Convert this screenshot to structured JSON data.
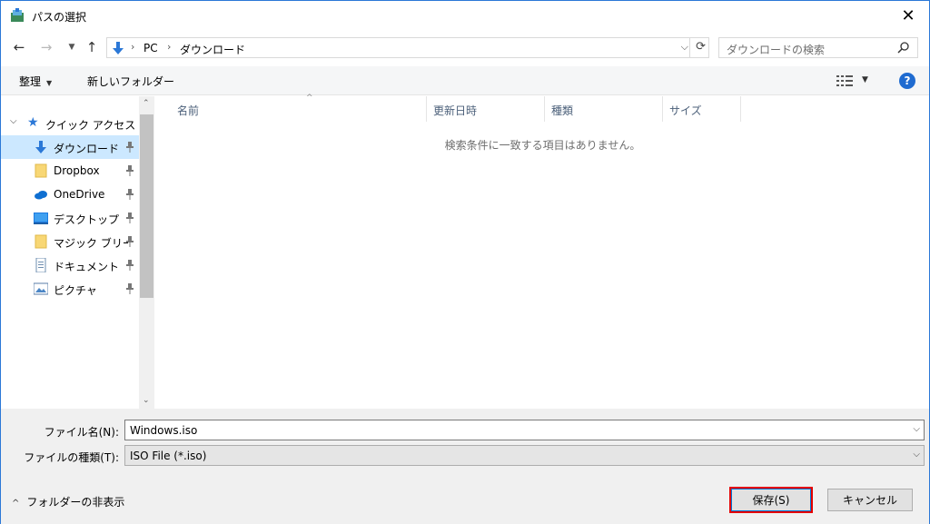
{
  "window": {
    "title": "パスの選択"
  },
  "address": {
    "segments": [
      "PC",
      "ダウンロード"
    ],
    "search_placeholder": "ダウンロードの検索"
  },
  "toolbar": {
    "organize_label": "整理",
    "new_folder_label": "新しいフォルダー",
    "help_label": "?"
  },
  "navpane": {
    "quick_access_label": "クイック アクセス",
    "items": [
      {
        "label": "ダウンロード",
        "icon": "download-arrow-icon",
        "selected": true
      },
      {
        "label": "Dropbox",
        "icon": "folder-icon"
      },
      {
        "label": "OneDrive",
        "icon": "cloud-icon"
      },
      {
        "label": "デスクトップ",
        "icon": "desktop-icon"
      },
      {
        "label": "マジック ブリーフ",
        "icon": "folder-icon"
      },
      {
        "label": "ドキュメント",
        "icon": "document-icon"
      },
      {
        "label": "ピクチャ",
        "icon": "picture-icon"
      }
    ]
  },
  "filelist": {
    "columns": [
      "名前",
      "更新日時",
      "種類",
      "サイズ"
    ],
    "empty_message": "検索条件に一致する項目はありません。"
  },
  "bottom": {
    "filename_label": "ファイル名(N):",
    "filename_value": "Windows.iso",
    "filetype_label": "ファイルの種類(T):",
    "filetype_value": "ISO File (*.iso)",
    "hide_folders_label": "フォルダーの非表示",
    "save_label": "保存(S)",
    "cancel_label": "キャンセル"
  },
  "colors": {
    "accent": "#2b78d7",
    "selection": "#cce8ff",
    "highlight_border": "#e50000"
  }
}
